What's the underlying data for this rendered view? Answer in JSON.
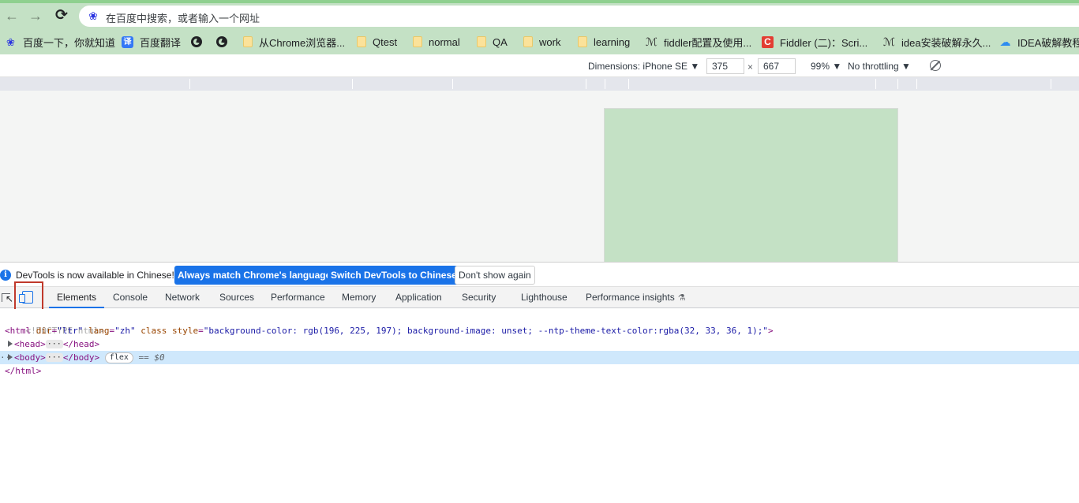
{
  "browser": {
    "omnibox_placeholder": "在百度中搜索，或者输入一个网址",
    "bookmarks": [
      {
        "label": "百度一下，你就知道",
        "icon": "baidu-icon"
      },
      {
        "label": "百度翻译",
        "icon": "translate-icon"
      },
      {
        "label": "",
        "icon": "globe-icon"
      },
      {
        "label": "",
        "icon": "globe-icon"
      },
      {
        "label": "从Chrome浏览器...",
        "icon": "folder-icon"
      },
      {
        "label": "Qtest",
        "icon": "folder-icon"
      },
      {
        "label": "normal",
        "icon": "folder-icon"
      },
      {
        "label": "QA",
        "icon": "folder-icon"
      },
      {
        "label": "work",
        "icon": "folder-icon"
      },
      {
        "label": "learning",
        "icon": "folder-icon"
      },
      {
        "label": "fiddler配置及使用...",
        "icon": "feather-icon"
      },
      {
        "label": "Fiddler (二)：Scri...",
        "icon": "csdn-icon"
      },
      {
        "label": "idea安装破解永久...",
        "icon": "feather-icon"
      },
      {
        "label": "IDEA破解教程",
        "icon": "cloud-icon"
      }
    ]
  },
  "device_toolbar": {
    "dimensions_label": "Dimensions: iPhone SE ▼",
    "width": "375",
    "height": "667",
    "times": "×",
    "zoom": "99% ▼",
    "throttling": "No throttling ▼"
  },
  "infobar": {
    "message": "DevTools is now available in Chinese!",
    "btn_match": "Always match Chrome's language",
    "btn_switch": "Switch DevTools to Chinese",
    "btn_dismiss": "Don't show again"
  },
  "tabs": [
    "Elements",
    "Console",
    "Network",
    "Sources",
    "Performance",
    "Memory",
    "Application",
    "Security",
    "Lighthouse",
    "Performance insights"
  ],
  "elements": {
    "doctype": "<!DOCTYPE html>",
    "html_open_tag": "<html",
    "html_attrs": [
      {
        "name": "dir",
        "value": "\"ltr\""
      },
      {
        "name": "lang",
        "value": "\"zh\""
      },
      {
        "name": "class",
        "value": ""
      },
      {
        "name": "style",
        "value": "\"background-color: rgb(196, 225, 197); background-image: unset; --ntp-theme-text-color:rgba(32, 33, 36, 1);\""
      }
    ],
    "gt": ">",
    "head_open": "<head>",
    "head_close": "</head>",
    "body_open": "<body>",
    "body_close": "</body>",
    "body_badge": "flex",
    "body_eq": "==",
    "body_var": "$0",
    "html_close": "</html>",
    "ellipsis": "···",
    "body_dots": "··"
  },
  "colors": {
    "accent": "#1a73e8",
    "page_background": "#c4e1c5",
    "highlight_box": "#c0392b"
  }
}
